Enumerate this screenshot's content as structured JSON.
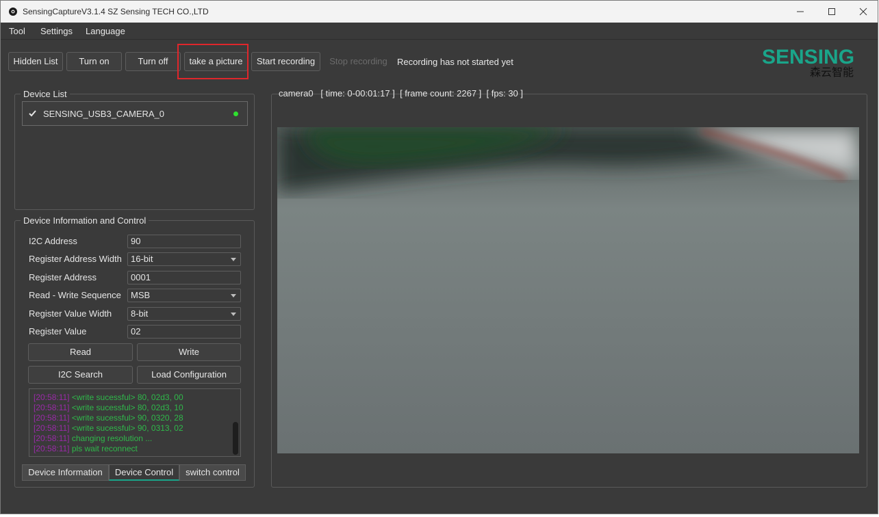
{
  "titlebar": {
    "title": "SensingCaptureV3.1.4 SZ Sensing TECH CO.,LTD",
    "icon": "camera-icon"
  },
  "menu": {
    "items": [
      "Tool",
      "Settings",
      "Language"
    ]
  },
  "toolbar": {
    "hidden_list": "Hidden List",
    "turn_on": "Turn on",
    "turn_off": "Turn off",
    "take_picture": "take a picture",
    "start_recording": "Start recording",
    "stop_recording": "Stop recording",
    "recording_status": "Recording has not started yet"
  },
  "logo": {
    "brand": "SENSING",
    "brand_cn": "森云智能",
    "accent_color": "#1aa58a"
  },
  "device_list": {
    "title": "Device List",
    "devices": [
      {
        "name": "SENSING_USB3_CAMERA_0",
        "checked": true,
        "status_color": "#2fe02f"
      }
    ]
  },
  "device_control": {
    "title": "Device Information and Control",
    "fields": {
      "i2c_address": {
        "label": "I2C Address",
        "value": "90"
      },
      "reg_addr_width": {
        "label": "Register Address Width",
        "value": "16-bit"
      },
      "reg_address": {
        "label": "Register Address",
        "value": "0001"
      },
      "rw_sequence": {
        "label": "Read - Write Sequence",
        "value": "MSB"
      },
      "reg_value_width": {
        "label": "Register Value Width",
        "value": "8-bit"
      },
      "reg_value": {
        "label": "Register Value",
        "value": "02"
      }
    },
    "buttons": {
      "read": "Read",
      "write": "Write",
      "i2c_search": "I2C Search",
      "load_config": "Load Configuration"
    },
    "log": [
      {
        "time": "[20:58:11]",
        "msg": "<write sucessful> 80, 02d3, 00"
      },
      {
        "time": "[20:58:11]",
        "msg": "<write sucessful> 80, 02d3, 10"
      },
      {
        "time": "[20:58:11]",
        "msg": "<write sucessful> 90, 0320, 28"
      },
      {
        "time": "[20:58:11]",
        "msg": "<write sucessful> 90, 0313, 02"
      },
      {
        "time": "[20:58:11]",
        "msg": "changing resolution ..."
      },
      {
        "time": "[20:58:11]",
        "msg": "pls wait reconnect"
      }
    ],
    "tabs": [
      "Device Information",
      "Device Control",
      "switch control"
    ],
    "active_tab": "Device Control"
  },
  "camera": {
    "name": "camera0",
    "time": "[ time: 0-00:01:17 ]",
    "frame_count": "[ frame count: 2267 ]",
    "fps": "[ fps: 30 ]"
  }
}
